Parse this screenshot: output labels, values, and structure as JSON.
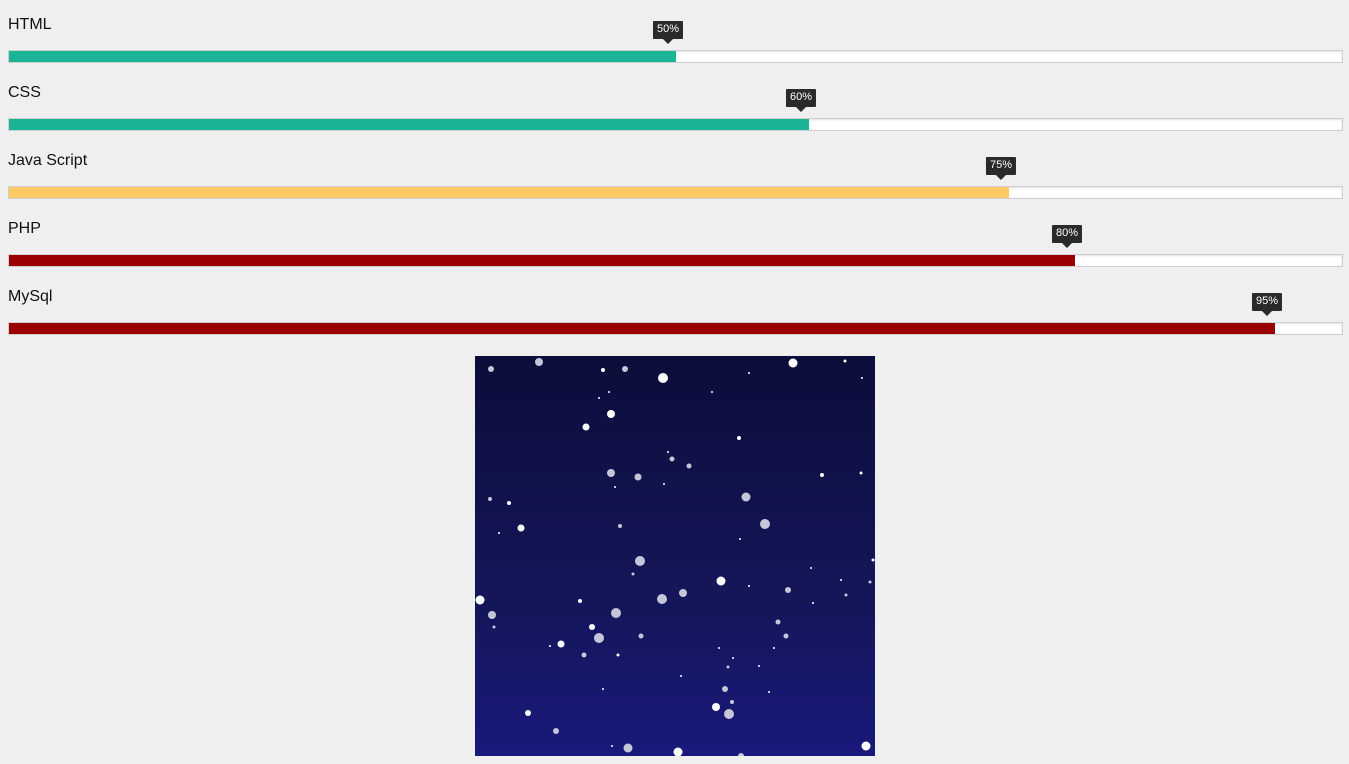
{
  "skills": [
    {
      "label": "HTML",
      "percent_label": "50%",
      "percent": 50,
      "color": "#1ab394"
    },
    {
      "label": "CSS",
      "percent_label": "60%",
      "percent": 60,
      "color": "#1ab394"
    },
    {
      "label": "Java Script",
      "percent_label": "75%",
      "percent": 75,
      "color": "#fdc965"
    },
    {
      "label": "PHP",
      "percent_label": "80%",
      "percent": 80,
      "color": "#990000"
    },
    {
      "label": "MySql",
      "percent_label": "95%",
      "percent": 95,
      "color": "#990000"
    }
  ],
  "night_panel": {
    "background_top": "#0c0d3a",
    "background_bottom": "#18197a",
    "particle_colors": [
      "#ffffff",
      "#c5c6d8"
    ]
  }
}
